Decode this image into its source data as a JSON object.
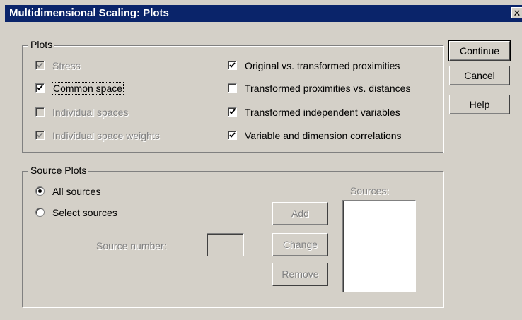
{
  "window": {
    "title": "Multidimensional Scaling: Plots",
    "close_glyph": "✕"
  },
  "plots": {
    "group_label": "Plots",
    "options": [
      {
        "label": "Stress",
        "checked": true,
        "enabled": false
      },
      {
        "label": "Common space",
        "checked": true,
        "enabled": true
      },
      {
        "label": "Individual spaces",
        "checked": false,
        "enabled": false
      },
      {
        "label": "Individual space weights",
        "checked": true,
        "enabled": false
      },
      {
        "label": "Original vs. transformed proximities",
        "checked": true,
        "enabled": true
      },
      {
        "label": "Transformed proximities vs. distances",
        "checked": false,
        "enabled": true
      },
      {
        "label": "Transformed independent variables",
        "checked": true,
        "enabled": true
      },
      {
        "label": "Variable and dimension correlations",
        "checked": true,
        "enabled": true
      }
    ]
  },
  "source_plots": {
    "group_label": "Source Plots",
    "all_sources_label": "All sources",
    "select_sources_label": "Select sources",
    "selected": "All sources",
    "source_number_label": "Source number:",
    "source_number_value": "",
    "sources_label": "Sources:",
    "add_label": "Add",
    "change_label": "Change",
    "remove_label": "Remove"
  },
  "buttons": {
    "continue_label": "Continue",
    "cancel_label": "Cancel",
    "help_label": "Help"
  },
  "colors": {
    "face": "#d4d0c8",
    "titlebar": "#0a246a",
    "disabled_text": "#808080"
  }
}
